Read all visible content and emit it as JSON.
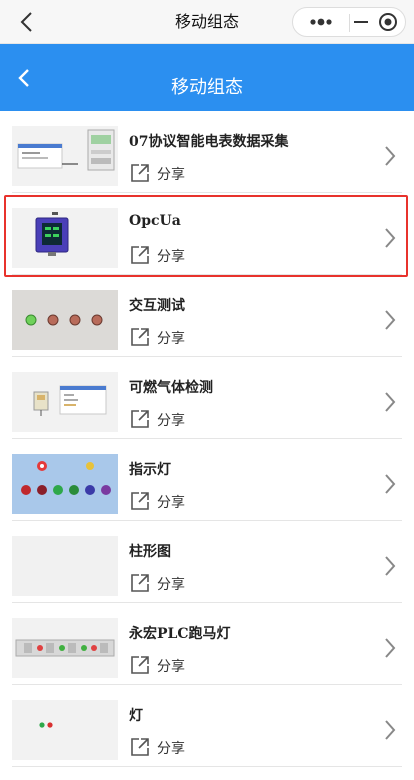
{
  "wechat_bar": {
    "title": "移动组态",
    "back_icon": "chevron-left-icon",
    "capsule": {
      "more_icon": "more-dots-icon",
      "minimize_icon": "minimize-icon",
      "close_icon": "target-close-icon"
    }
  },
  "header": {
    "title": "移动组态",
    "back_icon": "chevron-left-icon",
    "background": "#2b8ff0"
  },
  "list": {
    "share_label": "分享",
    "share_icon": "share-external-icon",
    "arrow_icon": "chevron-right-icon",
    "highlight_color": "#e8322c",
    "items": [
      {
        "name": "07协议智能电表数据采集"
      },
      {
        "name": "OpcUa",
        "highlighted": true
      },
      {
        "name": "交互测试"
      },
      {
        "name": "可燃气体检测"
      },
      {
        "name": "指示灯"
      },
      {
        "name": "柱形图"
      },
      {
        "name": "永宏PLC跑马灯"
      },
      {
        "name": "灯"
      }
    ]
  }
}
